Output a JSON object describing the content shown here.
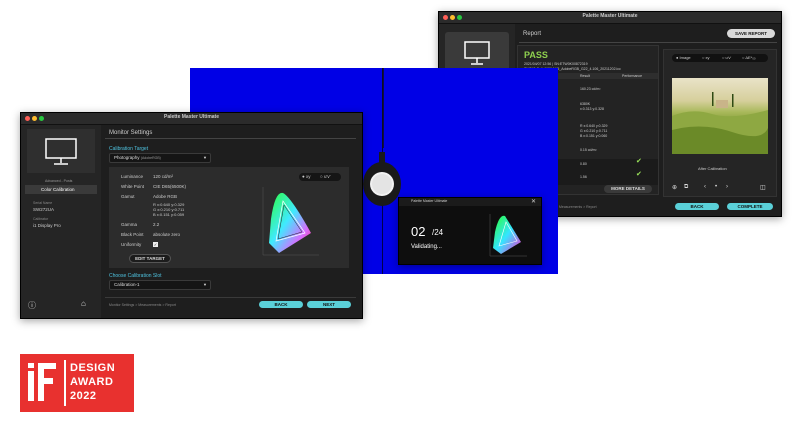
{
  "app_title": "Palette Master Ultimate",
  "win1": {
    "side_sub": "Advanced - Posts",
    "side_item": "Color Calibration",
    "model_label": "Serial Name",
    "model": "SW272UA",
    "calib_label": "Calibrator",
    "calibrator": "i1 Display Pro",
    "header": "Monitor Settings",
    "target_label": "Calibration Target",
    "target_value": "Photography",
    "target_sub": "(AdobeRGB)",
    "luminance_label": "Luminance",
    "luminance_value": "120 cd/m²",
    "white_label": "White Point",
    "white_value": "CIE D65(6500K)",
    "gamut_label": "Gamut",
    "gamut_value": "Adobe RGB",
    "gamut_r": "R  x:0.640  y:0.329",
    "gamut_g": "G  x:0.210  y:0.711",
    "gamut_b": "B  x:0.151  y:0.059",
    "gamma_label": "Gamma",
    "gamma_value": "2.2",
    "black_label": "Black Point",
    "black_value": "absolute zero",
    "uniformity_label": "Uniformity",
    "edit_target": "EDIT TARGET",
    "toggle_xy": "xy",
    "toggle_uv": "u'v'",
    "slot_label": "Choose Calibration Slot",
    "slot_value": "Calibration-1",
    "breadcrumb": "Monitor Settings  >  Measurements  >  Report",
    "back": "BACK",
    "next": "NEXT"
  },
  "win2": {
    "step": "02",
    "total": "/24",
    "status": "Validating..."
  },
  "win3": {
    "header": "Report",
    "save": "SAVE REPORT",
    "pass": "PASS",
    "line1": "2021/04/07 12:56  |  SN:ETW0K00872319",
    "line2": "SW240  Cali: 1106  1H5_AdobeRGB_G22_4.106_20211202.icc",
    "col_result": "Result",
    "col_perf": "Performance",
    "r1": "160.23 cd/m²",
    "r2a": "6380K",
    "r2b": "x:0.313  y:0.328",
    "r3a": "R  x:0.640  y:0.329",
    "r3b": "G  x:0.210  y:0.711",
    "r3c": "B  x:0.151  y:0.060",
    "r4": "0.15 cd/m²",
    "r5": "0.80",
    "r6": "1.56",
    "more": "MORE DETAILS",
    "tab_image": "Image",
    "tab_xy": "xy",
    "tab_uv": "u'v'",
    "tab_de": "ΔE*₀₀",
    "after": "After Calibration",
    "breadcrumb": "Measurements  >  Report",
    "back": "BACK",
    "complete": "COMPLETE"
  },
  "award": {
    "logo_text": "iF",
    "line1": "DESIGN",
    "line2": "AWARD",
    "line3": "2022",
    "color": "#e8312f"
  }
}
